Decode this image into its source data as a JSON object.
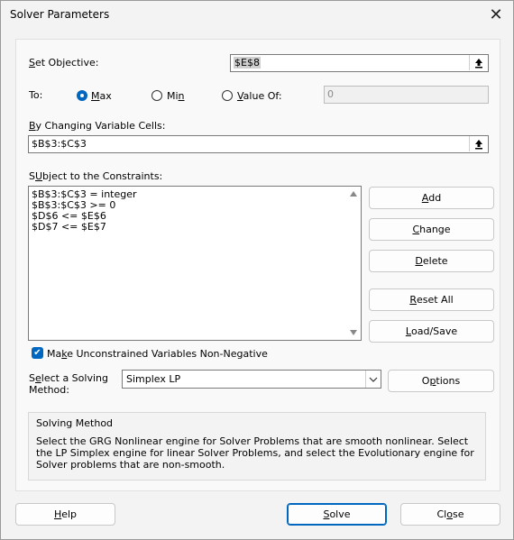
{
  "window": {
    "title": "Solver Parameters",
    "close_glyph": "✕"
  },
  "objective": {
    "label_underline": "S",
    "label_rest": "et Objective:",
    "value": "$E$8"
  },
  "to": {
    "label": "To:",
    "options": [
      {
        "underline": "M",
        "rest": "ax",
        "selected": true
      },
      {
        "underline": "",
        "pre": "Mi",
        "u": "n",
        "selected": false
      },
      {
        "underline": "V",
        "rest": "alue Of:",
        "selected": false
      }
    ],
    "value_of": "0"
  },
  "changing": {
    "label_underline": "B",
    "label_rest": "y Changing Variable Cells:",
    "value": "$B$3:$C$3"
  },
  "constraints": {
    "label_underline": "U",
    "label_pre": "S",
    "label_rest": "bject to the Constraints:",
    "items": [
      "$B$3:$C$3 = integer",
      "$B$3:$C$3 >= 0",
      "$D$6 <= $E$6",
      "$D$7 <= $E$7"
    ]
  },
  "buttons": {
    "add": {
      "u": "A",
      "rest": "dd"
    },
    "change": {
      "u": "C",
      "rest": "hange"
    },
    "delete": {
      "u": "D",
      "rest": "elete"
    },
    "reset": {
      "u": "R",
      "rest": "eset All"
    },
    "loadsave": {
      "u": "L",
      "rest": "oad/Save"
    },
    "options": {
      "pre": "O",
      "u": "p",
      "rest": "tions"
    },
    "help": {
      "u": "H",
      "rest": "elp"
    },
    "solve": {
      "u": "S",
      "rest": "olve"
    },
    "close": {
      "pre": "Cl",
      "u": "o",
      "rest": "se"
    }
  },
  "nonneg": {
    "checked": true,
    "pre": "Ma",
    "u": "k",
    "rest": "e Unconstrained Variables Non-Negative"
  },
  "method": {
    "label_line1_pre": "S",
    "label_line1_u": "e",
    "label_line1_rest": "lect a Solving",
    "label_line2": "Method:",
    "value": "Simplex LP"
  },
  "solving_method": {
    "title": "Solving Method",
    "text": "Select the GRG Nonlinear engine for Solver Problems that are smooth nonlinear. Select the LP Simplex engine for linear Solver Problems, and select the Evolutionary engine for Solver problems that are non-smooth."
  },
  "colors": {
    "accent": "#0067c0",
    "background": "#f3f3f3"
  }
}
